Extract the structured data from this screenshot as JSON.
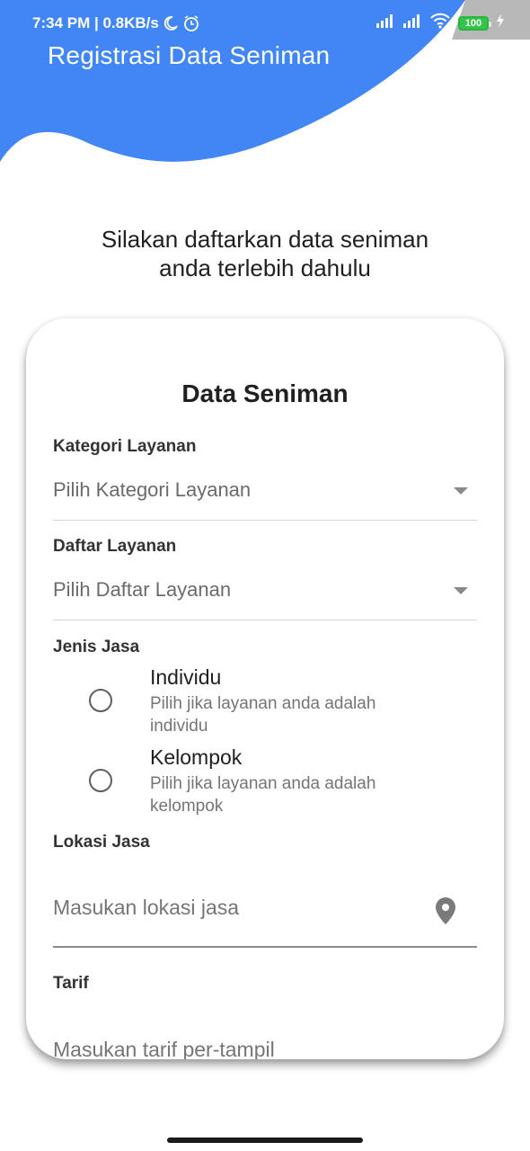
{
  "status_bar": {
    "left_text": "7:34 PM | 0.8KB/s",
    "battery": "100",
    "icons": [
      "moon-icon",
      "alarm-icon",
      "signal-icon",
      "signal-icon",
      "wifi-icon",
      "battery-icon",
      "charging-icon"
    ]
  },
  "header": {
    "title": "Registrasi Data Seniman",
    "color": "#4285f4"
  },
  "intro": {
    "line1": "Silakan daftarkan data seniman",
    "line2": "anda terlebih dahulu"
  },
  "form": {
    "title": "Data Seniman",
    "kategori": {
      "label": "Kategori Layanan",
      "value": "Pilih Kategori Layanan"
    },
    "daftar": {
      "label": "Daftar Layanan",
      "value": "Pilih Daftar Layanan"
    },
    "jenis": {
      "label": "Jenis Jasa",
      "options": [
        {
          "title": "Individu",
          "subtitle": "Pilih jika layanan anda adalah individu"
        },
        {
          "title": "Kelompok",
          "subtitle": "Pilih jika layanan anda adalah kelompok"
        }
      ]
    },
    "lokasi": {
      "label": "Lokasi Jasa",
      "placeholder": "Masukan lokasi jasa"
    },
    "tarif": {
      "label": "Tarif",
      "placeholder": "Masukan tarif per-tampil"
    }
  }
}
